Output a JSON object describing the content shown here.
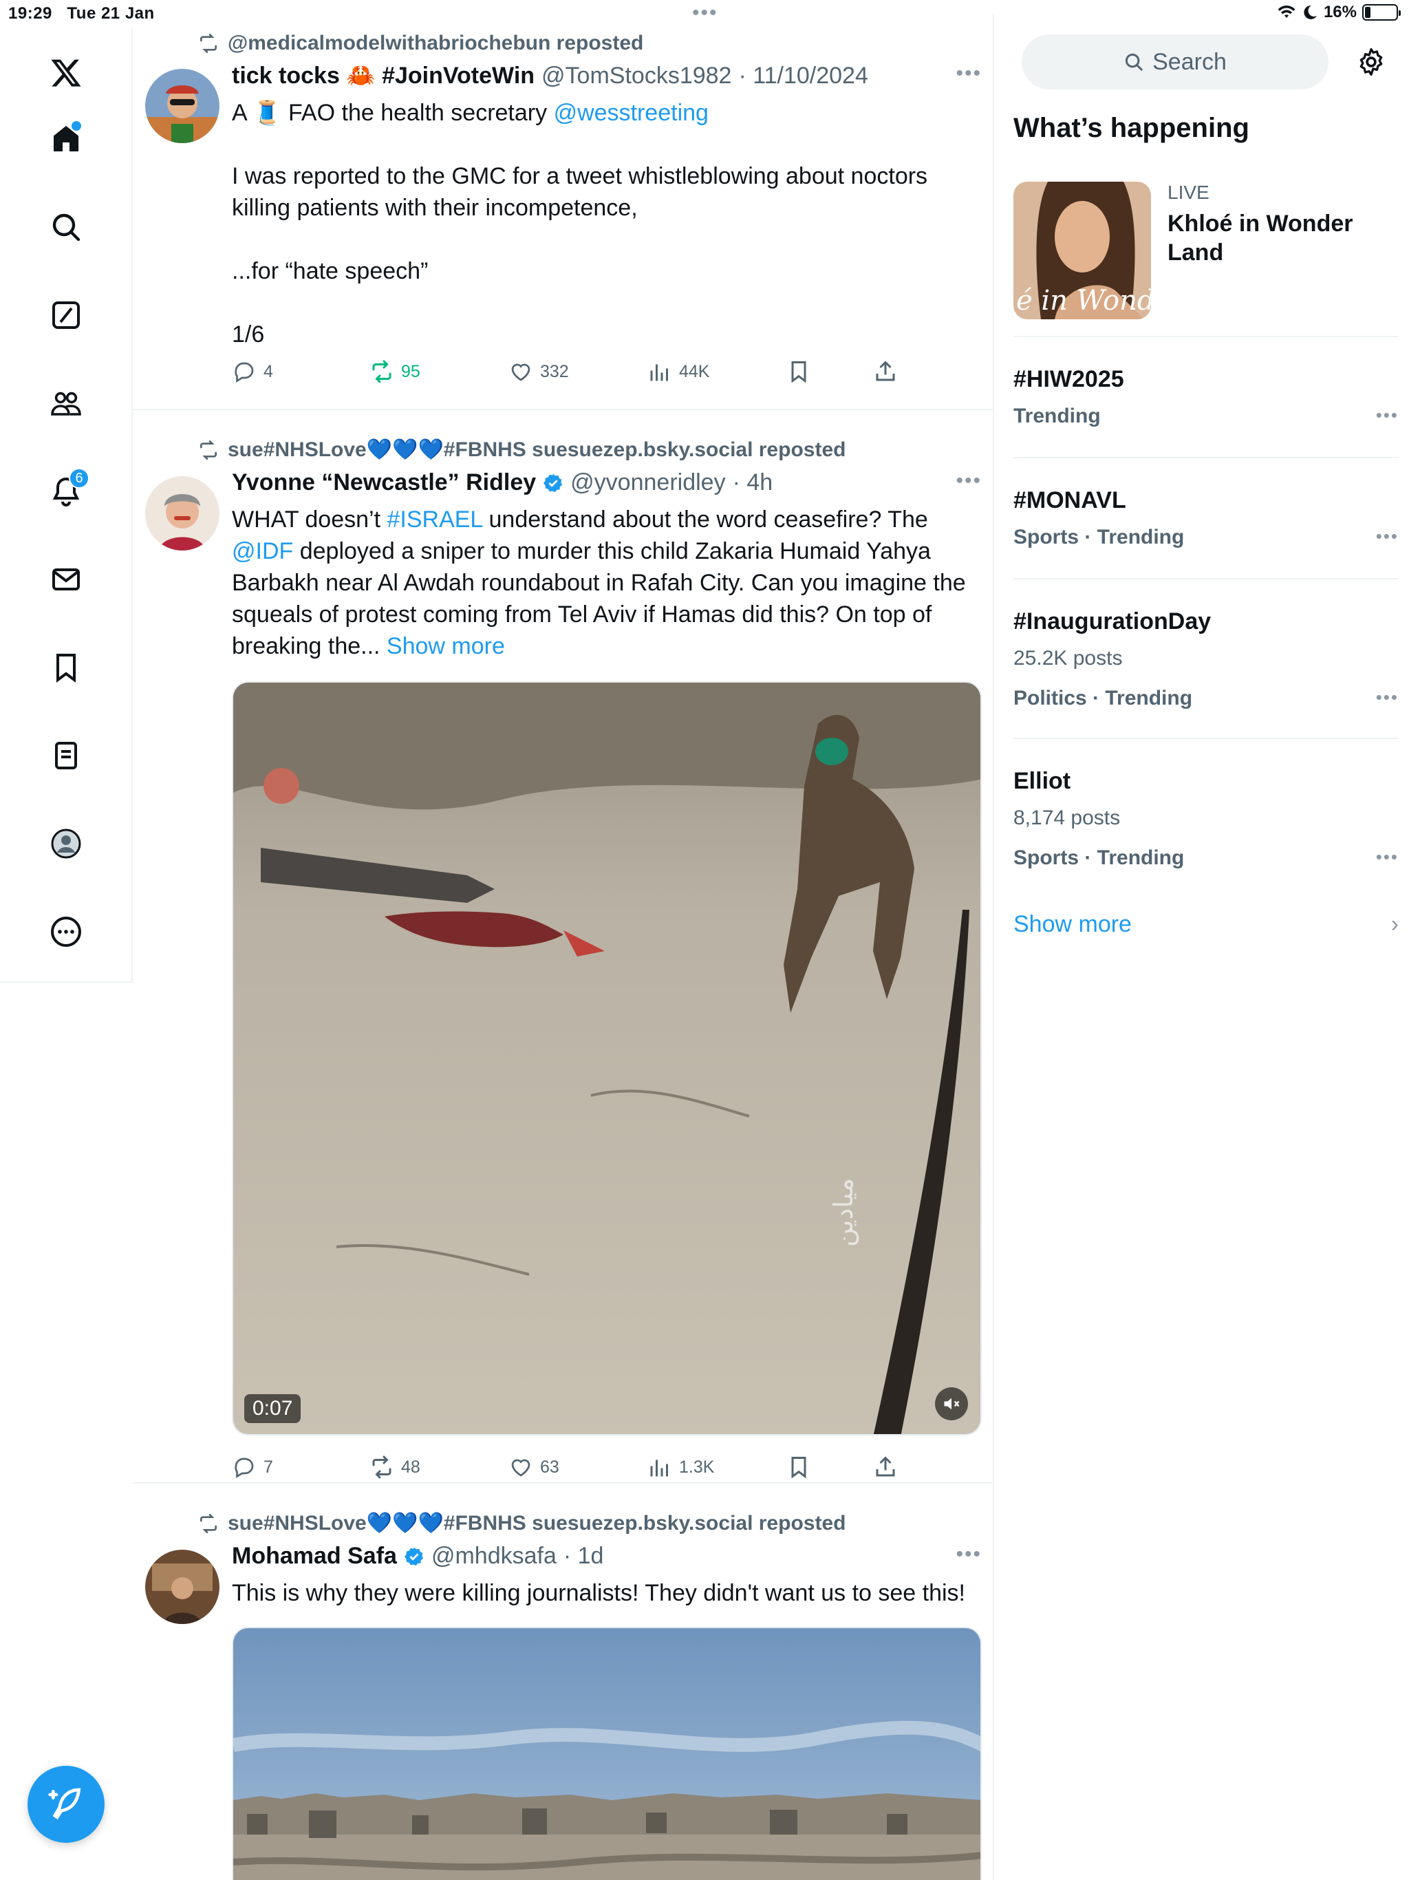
{
  "status_bar": {
    "time": "19:29",
    "date": "Tue 21 Jan",
    "battery": "16%"
  },
  "nav": {
    "notifications_badge": "6"
  },
  "feed": {
    "tweets": [
      {
        "repost_label": "@medicalmodelwithabriochebun reposted",
        "name": "tick tocks 🦀 #JoinVoteWin",
        "handle": "@TomStocks1982",
        "time": "· 11/10/2024",
        "body_prefix": "A 🧵 FAO the health secretary ",
        "body_mention": "@wesstreeting",
        "body_rest": "\n\nI was reported to the GMC for a tweet whistleblowing about noctors killing patients with their incompetence,\n\n...for “hate speech”\n\n1/6",
        "replies": "4",
        "reposts": "95",
        "likes": "332",
        "views": "44K"
      },
      {
        "repost_label": "sue#NHSLove💙💙💙#FBNHS suesuezep.bsky.social reposted",
        "name": "Yvonne “Newcastle” Ridley",
        "handle": "@yvonneridley",
        "time": "· 4h",
        "b1": "WHAT doesn’t ",
        "b2": "#ISRAEL",
        "b3": " understand about the word ceasefire? The ",
        "b4": "@IDF",
        "b5": " deployed a sniper to murder this child Zakaria Humaid Yahya Barbakh near Al Awdah roundabout in Rafah City. Can you imagine the squeals of protest coming from Tel Aviv if Hamas did this? On top of breaking the... ",
        "show_more": "Show more",
        "video_time": "0:07",
        "replies": "7",
        "reposts": "48",
        "likes": "63",
        "views": "1.3K"
      },
      {
        "repost_label": "sue#NHSLove💙💙💙#FBNHS suesuezep.bsky.social reposted",
        "name": "Mohamad Safa",
        "handle": "@mhdksafa",
        "time": "· 1d",
        "body": "This is why they were killing journalists! They didn't want us to see this!"
      }
    ]
  },
  "sidebar": {
    "search_placeholder": "Search",
    "section_title": "What’s happening",
    "live": {
      "label": "LIVE",
      "title": "Khloé in Wonder Land",
      "image_text": "é in Wonder L"
    },
    "trends": [
      {
        "name": "#HIW2025",
        "count": "",
        "category": "Trending"
      },
      {
        "name": "#MONAVL",
        "count": "",
        "category": "Sports · Trending"
      },
      {
        "name": "#InaugurationDay",
        "count": "25.2K posts",
        "category": "Politics · Trending"
      },
      {
        "name": "Elliot",
        "count": "8,174 posts",
        "category": "Sports · Trending"
      }
    ],
    "show_more": "Show more"
  },
  "colors": {
    "accent": "#1d9bf0",
    "repost_active": "#00ba7c",
    "text_secondary": "#536471"
  }
}
